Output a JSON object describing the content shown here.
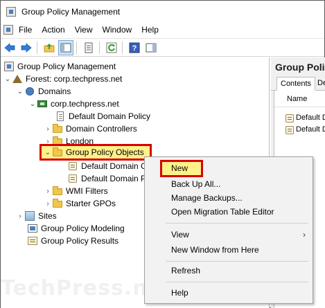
{
  "window": {
    "title": "Group Policy Management"
  },
  "menubar": {
    "items": [
      "File",
      "Action",
      "View",
      "Window",
      "Help"
    ]
  },
  "toolbar": {
    "buttons": [
      "back-arrow-icon",
      "forward-arrow-icon",
      "up-folder-icon",
      "show-hide-tree-icon",
      "properties-icon",
      "refresh-icon",
      "help-icon",
      "action-pane-icon"
    ]
  },
  "tree": {
    "root": "Group Policy Management",
    "forest": "Forest: corp.techpress.net",
    "domains": "Domains",
    "domain": "corp.techpress.net",
    "default_domain_policy": "Default Domain Policy",
    "domain_controllers": "Domain Controllers",
    "london": "London",
    "gpo_container": "Group Policy Objects",
    "gpo_child_1": "Default Domain C",
    "gpo_child_2": "Default Domain P",
    "wmi_filters": "WMI Filters",
    "starter_gpos": "Starter GPOs",
    "sites": "Sites",
    "modeling": "Group Policy Modeling",
    "results": "Group Policy Results"
  },
  "right_pane": {
    "title": "Group Polic",
    "tab_active": "Contents",
    "tab_other": "De",
    "column_header": "Name",
    "rows": [
      "Default D",
      "Default D"
    ]
  },
  "context_menu": {
    "new": "New",
    "backup_all": "Back Up All...",
    "manage_backups": "Manage Backups...",
    "open_migration": "Open Migration Table Editor",
    "view": "View",
    "new_window": "New Window from Here",
    "refresh": "Refresh",
    "help": "Help",
    "submenu_arrow": "›"
  },
  "watermark": "TechPress.net",
  "colors": {
    "highlight_fill": "#fff18a",
    "highlight_border": "#d80000"
  }
}
